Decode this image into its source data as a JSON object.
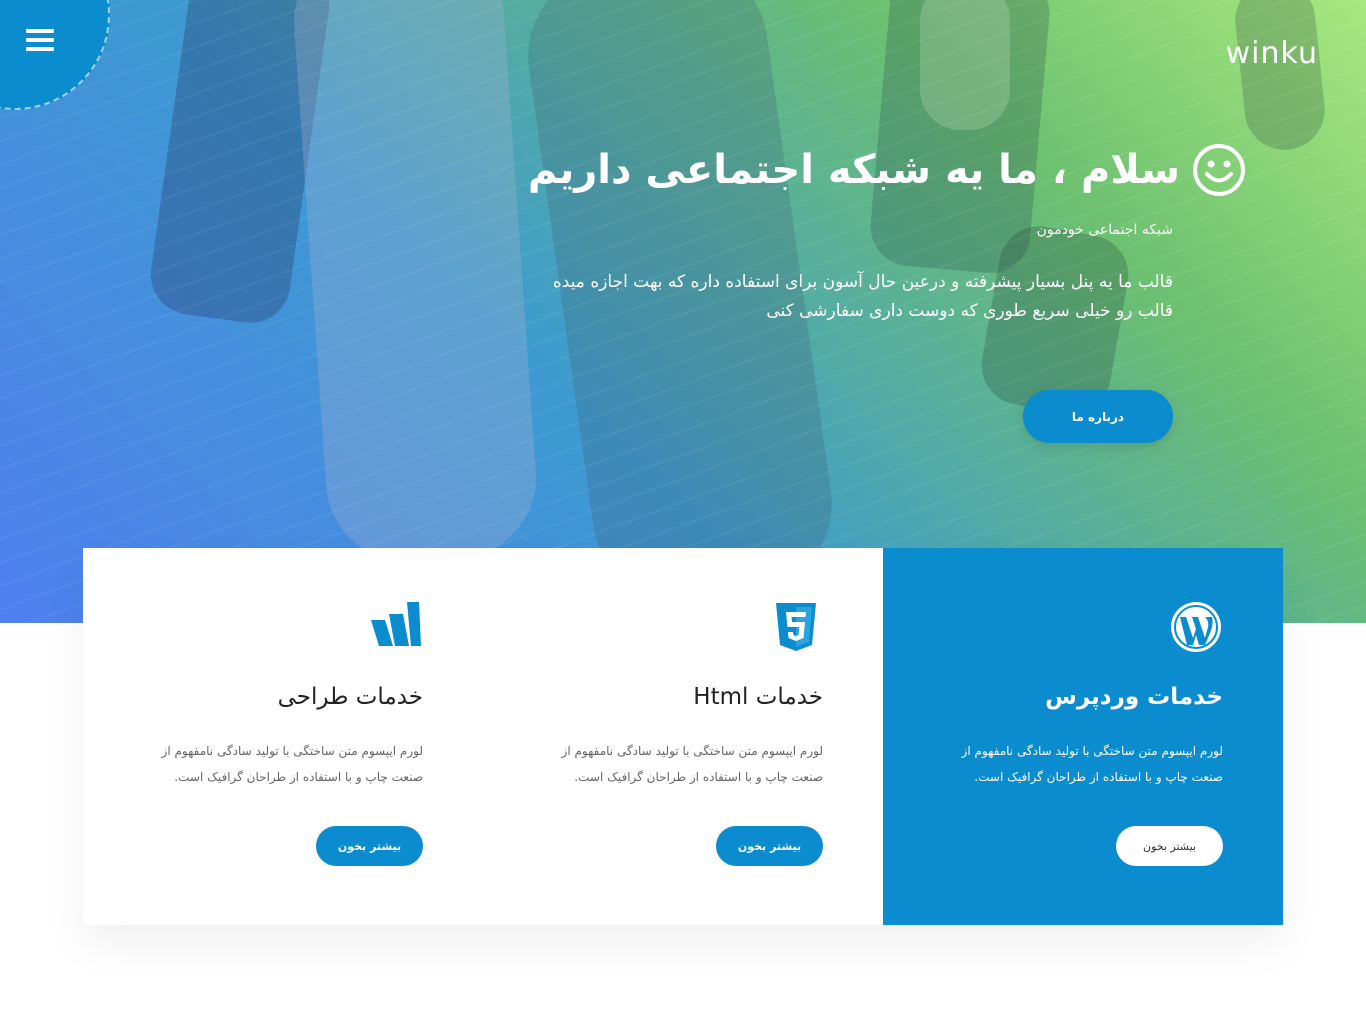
{
  "header": {
    "logo_text": "winku",
    "menu_icon": "hamburger-icon"
  },
  "hero": {
    "title": "سلام ، ما یه شبکه اجتماعی داریم",
    "title_icon": "smile-icon",
    "subtitle": "شبکه اجتماعی خودمون",
    "description": "قالب ما یه پنل بسیار پیشرفته و درعین حال آسون برای استفاده داره که بهت اجازه میده قالب رو خیلی سریع طوری که دوست داری سفارشی کنی",
    "button_label": "درباره ما"
  },
  "services": [
    {
      "icon": "wordpress-icon",
      "title": "خدمات وردپرس",
      "text": "لورم ایپسوم متن ساختگی با تولید سادگی نامفهوم از صنعت چاپ و با استفاده از طراحان گرافیک است.",
      "button_label": "بیشتر بخون",
      "active": true
    },
    {
      "icon": "html5-icon",
      "title": "خدمات Html",
      "text": "لورم ایپسوم متن ساختگی با تولید سادگی نامفهوم از صنعت چاپ و با استفاده از طراحان گرافیک است.",
      "button_label": "بیشتر بخون",
      "active": false
    },
    {
      "icon": "design-icon",
      "title": "خدمات طراحی",
      "text": "لورم ایپسوم متن ساختگی با تولید سادگی نامفهوم از صنعت چاپ و با استفاده از طراحان گرافیک است.",
      "button_label": "بیشتر بخون",
      "active": false
    }
  ],
  "colors": {
    "accent": "#0a8ccf",
    "gradient_start": "#4f7ff0",
    "gradient_end": "#a8e87e"
  }
}
